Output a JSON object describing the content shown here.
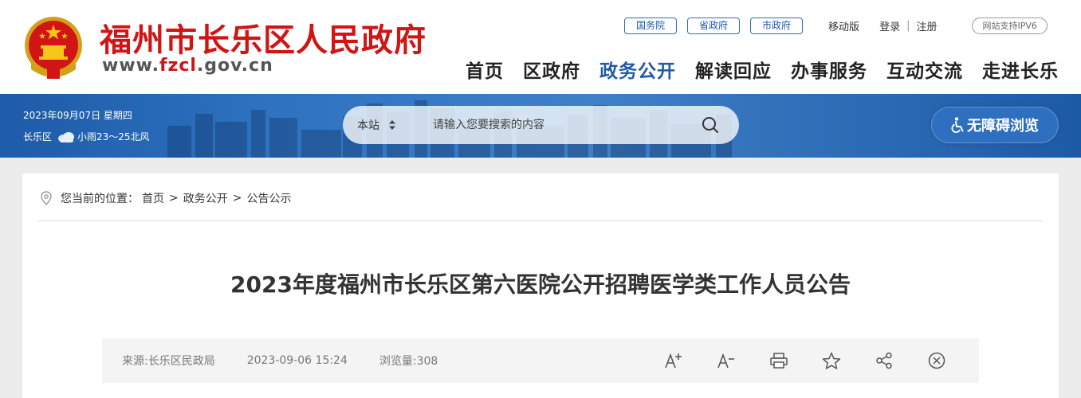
{
  "header": {
    "site_title": "福州市长乐区人民政府",
    "site_url_prefix": "www.",
    "site_url_domain": "fzcl",
    "site_url_suffix": ".gov.cn",
    "top_links": {
      "state_council": "国务院",
      "provincial": "省政府",
      "municipal": "市政府",
      "mobile": "移动版",
      "login": "登录",
      "register": "注册",
      "separator": "|",
      "ipv6": "网站支持IPV6"
    },
    "nav": [
      "首页",
      "区政府",
      "政务公开",
      "解读回应",
      "办事服务",
      "互动交流",
      "走进长乐"
    ],
    "nav_active_index": 2
  },
  "banner": {
    "date": "2023年09月07日 星期四",
    "district": "长乐区",
    "weather": "小雨23～25北风",
    "search_scope": "本站",
    "search_placeholder": "请输入您要搜索的内容",
    "accessibility_label": "无障碍浏览"
  },
  "breadcrumb": {
    "prefix": "您当前的位置：",
    "items": [
      "首页",
      "政务公开",
      "公告公示"
    ],
    "arrow": ">"
  },
  "article": {
    "title": "2023年度福州市长乐区第六医院公开招聘医学类工作人员公告",
    "source": "来源:长乐区民政局",
    "datetime": "2023-09-06 15:24",
    "views": "浏览量:308"
  },
  "colors": {
    "brand_red": "#d11414",
    "brand_blue": "#1f5aa6"
  }
}
